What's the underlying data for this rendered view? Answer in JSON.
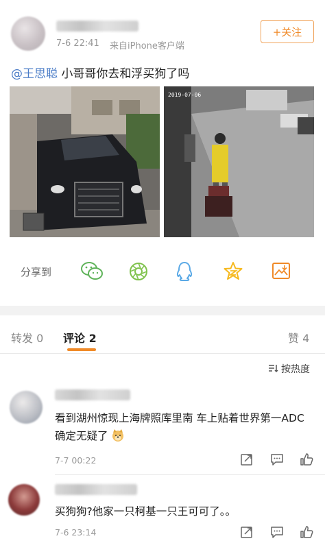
{
  "post": {
    "time": "7-6 22:41",
    "source": "来自iPhone客户端",
    "follow_label": "+关注",
    "mention": "@王思聪",
    "text": " 小哥哥你去和浮买狗了吗",
    "photo2_timestamp": "2019-07-06"
  },
  "share": {
    "label": "分享到",
    "icons": [
      "wechat-icon",
      "moments-icon",
      "qq-icon",
      "qzone-icon",
      "save-image-icon"
    ]
  },
  "tabs": {
    "repost": "转发 0",
    "comment": "评论 2",
    "like": "赞 4"
  },
  "sort": {
    "label": "按热度"
  },
  "comments": [
    {
      "text": "看到湖州惊现上海牌照库里南 车上贴着世界第一ADC 确定无疑了",
      "time": "7-7 00:22"
    },
    {
      "text": "买狗狗?他家一只柯基一只王可可了。。",
      "time": "7-6 23:14"
    }
  ],
  "colors": {
    "accent": "#f08a28",
    "mention": "#4a7cc7",
    "wechat": "#5fb35a",
    "moments": "#7fc24c",
    "qq": "#5aa9e6",
    "qzone": "#f6b91e",
    "save": "#f08a28"
  }
}
